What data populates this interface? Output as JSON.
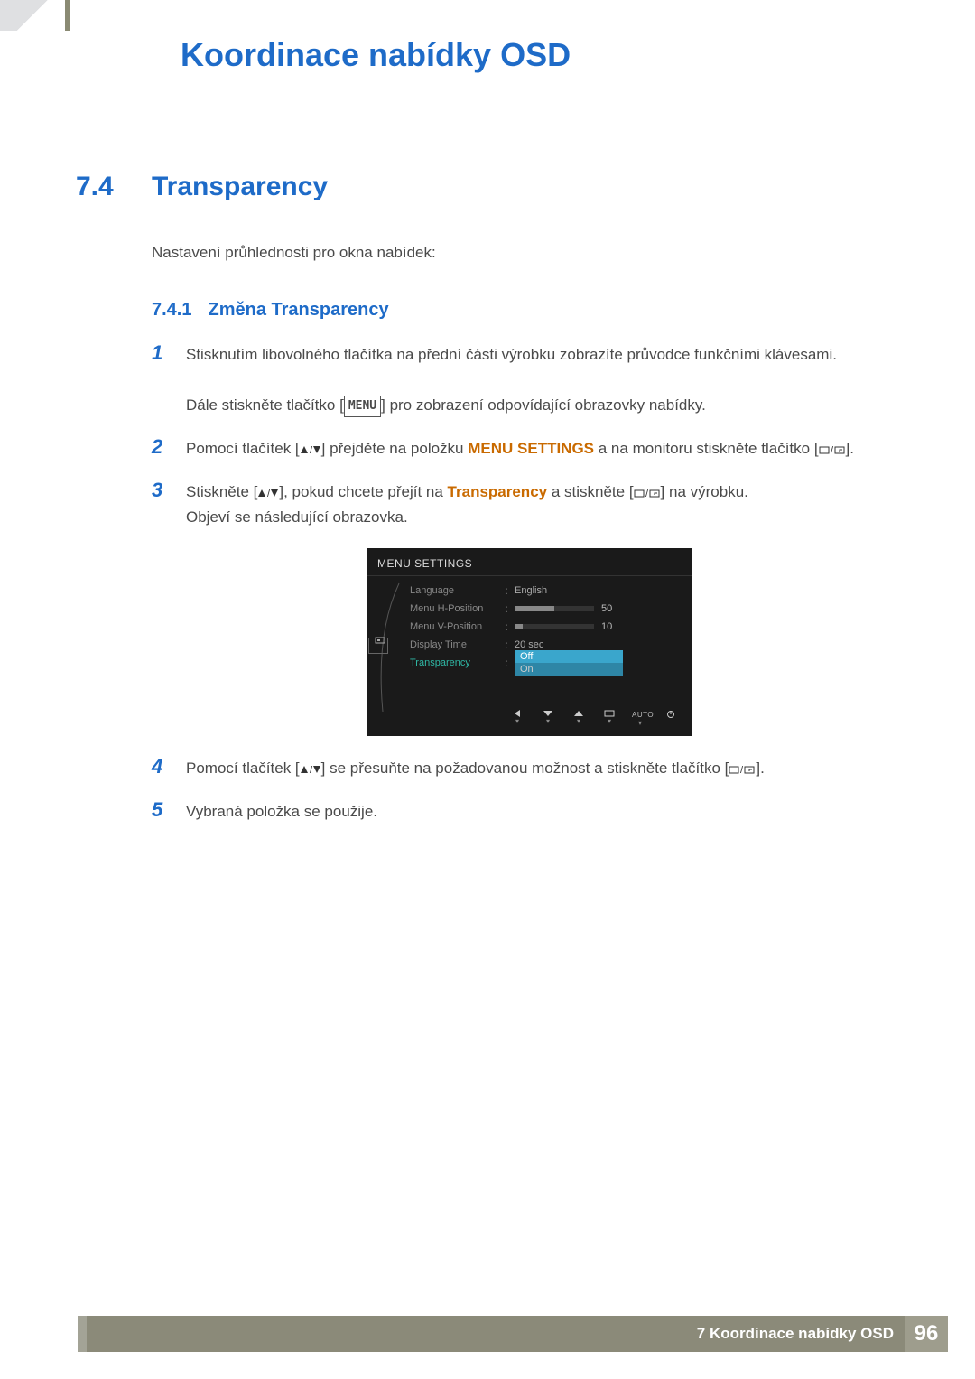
{
  "chapter_title": "Koordinace nabídky OSD",
  "section": {
    "num": "7.4",
    "title": "Transparency"
  },
  "intro": "Nastavení průhlednosti pro okna nabídek:",
  "subsection": {
    "num": "7.4.1",
    "title": "Změna Transparency"
  },
  "steps": {
    "s1": {
      "num": "1",
      "line1": "Stisknutím libovolného tlačítka na přední části výrobku zobrazíte průvodce funkčními klávesami.",
      "line2a": "Dále stiskněte tlačítko [",
      "menu_token": "MENU",
      "line2b": "] pro zobrazení odpovídající obrazovky nabídky."
    },
    "s2": {
      "num": "2",
      "a": "Pomocí tlačítek [",
      "b": "] přejděte na položku ",
      "hl": "MENU SETTINGS",
      "c": " a na monitoru stiskněte tlačítko [",
      "d": "]."
    },
    "s3": {
      "num": "3",
      "a": "Stiskněte [",
      "b": "], pokud chcete přejít na ",
      "hl": "Transparency",
      "c": " a stiskněte [",
      "d": "] na výrobku.",
      "post": "Objeví se následující obrazovka."
    },
    "s4": {
      "num": "4",
      "a": "Pomocí tlačítek [",
      "b": "] se přesuňte na požadovanou možnost a stiskněte tlačítko [",
      "c": "]."
    },
    "s5": {
      "num": "5",
      "text": "Vybraná položka se použije."
    }
  },
  "osd": {
    "title": "MENU SETTINGS",
    "rows": {
      "language": {
        "label": "Language",
        "value": "English"
      },
      "hpos": {
        "label": "Menu H-Position",
        "value": "50",
        "fill": 50
      },
      "vpos": {
        "label": "Menu V-Position",
        "value": "10",
        "fill": 10
      },
      "dtime": {
        "label": "Display Time",
        "value": "20 sec"
      },
      "transp": {
        "label": "Transparency",
        "opt_off": "Off",
        "opt_on": "On"
      }
    },
    "footer_auto": "AUTO"
  },
  "footer": {
    "chapter_ref": "7 Koordinace nabídky OSD",
    "page": "96"
  }
}
